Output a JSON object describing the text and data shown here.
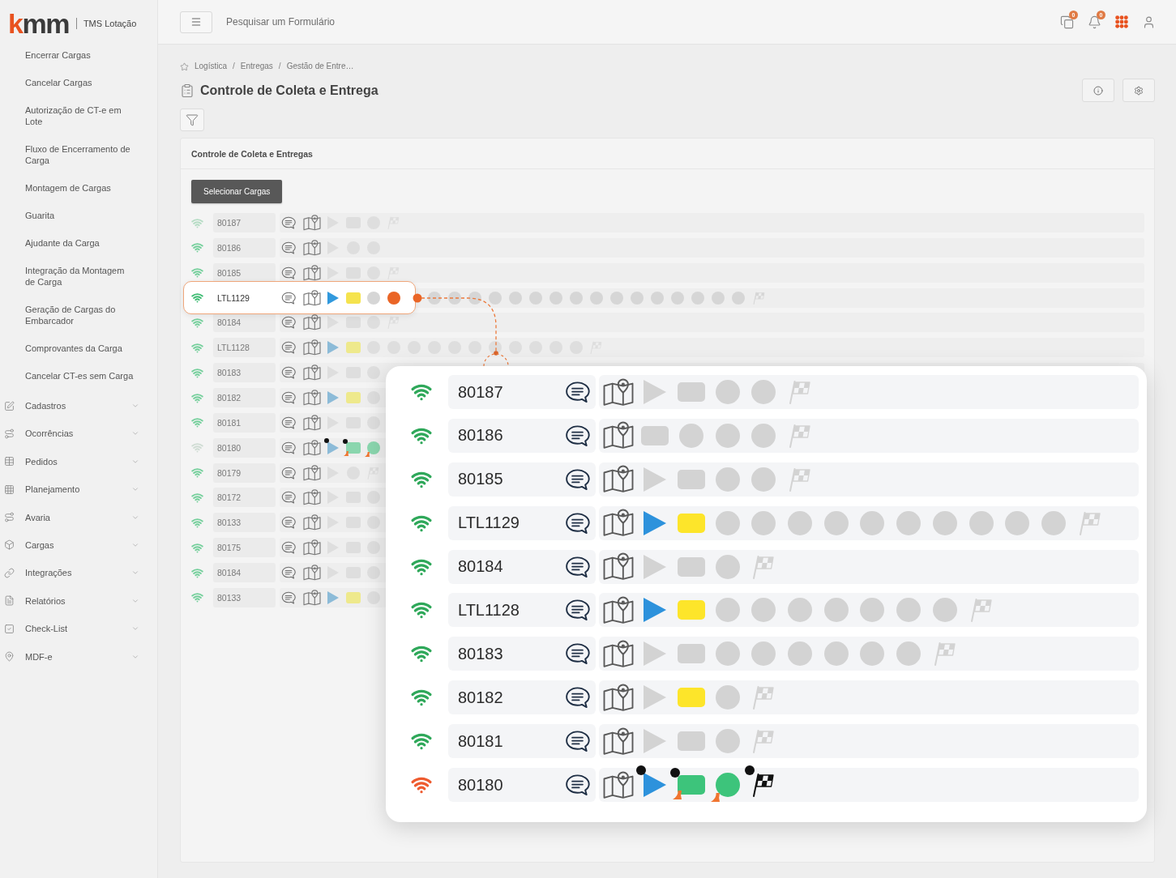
{
  "sidebar": {
    "logo": {
      "accent": "k",
      "rest": "mm",
      "product": "TMS Lotação"
    },
    "links": [
      "Encerrar Cargas",
      "Cancelar Cargas",
      "Autorização de CT-e em Lote",
      "Fluxo de Encerramento de Carga",
      "Montagem de Cargas",
      "Guarita",
      "Ajudante da Carga",
      "Integração da Montagem de Carga",
      "Geração de Cargas do Embarcador",
      "Comprovantes da Carga",
      "Cancelar CT-es sem Carga"
    ],
    "groups": [
      {
        "label": "Cadastros",
        "expanded": false
      },
      {
        "label": "Ocorrências",
        "expanded": false
      },
      {
        "label": "Pedidos",
        "expanded": false
      },
      {
        "label": "Planejamento",
        "expanded": false
      },
      {
        "label": "Avaria",
        "expanded": false
      },
      {
        "label": "Cargas",
        "expanded": false
      },
      {
        "label": "Integrações",
        "expanded": false
      },
      {
        "label": "Relatórios",
        "expanded": false
      },
      {
        "label": "Check-List",
        "expanded": false
      },
      {
        "label": "MDF-e",
        "expanded": false
      }
    ]
  },
  "topbar": {
    "search": {
      "placeholder": "Pesquisar um Formulário"
    },
    "badges": [
      "0",
      "0"
    ]
  },
  "breadcrumb": {
    "items": [
      "Logística",
      "Entregas",
      "Gestão de Entre…"
    ],
    "separator": "/"
  },
  "page": {
    "title": "Controle de Coleta e Entrega"
  },
  "card": {
    "title": "Controle de Coleta e Entregas",
    "button": "Selecionar Cargas",
    "rows": [
      {
        "id": "80187",
        "color": "#b5dcc4",
        "selected": false,
        "steps": [
          {
            "kind": "start",
            "done": false
          },
          {
            "kind": "stop",
            "done": false
          },
          {
            "kind": "point",
            "done": false
          },
          {
            "kind": "finish",
            "done": false
          }
        ]
      },
      {
        "id": "80186",
        "color": "#74cf9b",
        "selected": false,
        "steps": [
          {
            "kind": "start",
            "done": false
          },
          {
            "kind": "point",
            "done": false
          },
          {
            "kind": "point",
            "done": false
          }
        ]
      },
      {
        "id": "80185",
        "color": "#74cf9b",
        "selected": false,
        "steps": [
          {
            "kind": "start",
            "done": false
          },
          {
            "kind": "stop",
            "done": false
          },
          {
            "kind": "point",
            "done": false
          },
          {
            "kind": "finish",
            "done": false
          }
        ]
      },
      {
        "id": "LTL1129",
        "color": "#3dbb72",
        "selected": true,
        "steps": [
          {
            "kind": "start",
            "done": true
          },
          {
            "kind": "stop",
            "done": false,
            "active": true
          },
          {
            "kind": "point",
            "done": false
          },
          {
            "kind": "point",
            "done": false,
            "highlighted": true
          },
          {
            "kind": "point",
            "done": false
          },
          {
            "kind": "point",
            "done": false
          },
          {
            "kind": "point",
            "done": false
          },
          {
            "kind": "point",
            "done": false
          },
          {
            "kind": "point",
            "done": false
          },
          {
            "kind": "point",
            "done": false
          },
          {
            "kind": "point",
            "done": false
          },
          {
            "kind": "point",
            "done": false
          },
          {
            "kind": "point",
            "done": false
          },
          {
            "kind": "point",
            "done": false
          },
          {
            "kind": "point",
            "done": false
          },
          {
            "kind": "point",
            "done": false
          },
          {
            "kind": "point",
            "done": false
          },
          {
            "kind": "point",
            "done": false
          },
          {
            "kind": "point",
            "done": false
          },
          {
            "kind": "point",
            "done": false
          },
          {
            "kind": "finish",
            "done": false
          }
        ]
      },
      {
        "id": "80184",
        "color": "#74cf9b",
        "selected": false,
        "steps": [
          {
            "kind": "start",
            "done": false
          },
          {
            "kind": "stop",
            "done": false
          },
          {
            "kind": "point",
            "done": false
          },
          {
            "kind": "finish",
            "done": false
          }
        ]
      },
      {
        "id": "LTL1128",
        "color": "#74cf9b",
        "selected": false,
        "steps": [
          {
            "kind": "start",
            "done": true
          },
          {
            "kind": "stop",
            "done": false,
            "active": true
          },
          {
            "kind": "point",
            "done": false
          },
          {
            "kind": "point",
            "done": false
          },
          {
            "kind": "point",
            "done": false
          },
          {
            "kind": "point",
            "done": false
          },
          {
            "kind": "point",
            "done": false
          },
          {
            "kind": "point",
            "done": false
          },
          {
            "kind": "point",
            "done": false
          },
          {
            "kind": "point",
            "done": false
          },
          {
            "kind": "point",
            "done": false
          },
          {
            "kind": "point",
            "done": false
          },
          {
            "kind": "point",
            "done": false
          },
          {
            "kind": "finish",
            "done": false
          }
        ]
      },
      {
        "id": "80183",
        "color": "#74cf9b",
        "selected": false,
        "steps": [
          {
            "kind": "start",
            "done": false
          },
          {
            "kind": "stop",
            "done": false
          },
          {
            "kind": "point",
            "done": false
          }
        ]
      },
      {
        "id": "80182",
        "color": "#74cf9b",
        "selected": false,
        "steps": [
          {
            "kind": "start",
            "done": true
          },
          {
            "kind": "stop",
            "done": false,
            "active": true
          },
          {
            "kind": "point",
            "done": false
          }
        ]
      },
      {
        "id": "80181",
        "color": "#74cf9b",
        "selected": false,
        "steps": [
          {
            "kind": "start",
            "done": false
          },
          {
            "kind": "stop",
            "done": false
          },
          {
            "kind": "point",
            "done": false
          }
        ]
      },
      {
        "id": "80180",
        "color": "#cfdcd3",
        "selected": false,
        "steps": [
          {
            "kind": "start",
            "done": true,
            "dot": true
          },
          {
            "kind": "stop",
            "done": true,
            "dot": true,
            "tail": true
          },
          {
            "kind": "point",
            "done": true,
            "tail": true
          }
        ]
      },
      {
        "id": "80179",
        "color": "#74cf9b",
        "selected": false,
        "steps": [
          {
            "kind": "start",
            "done": false
          },
          {
            "kind": "point",
            "done": false
          },
          {
            "kind": "finish",
            "done": false
          }
        ]
      },
      {
        "id": "80172",
        "color": "#74cf9b",
        "selected": false,
        "steps": [
          {
            "kind": "start",
            "done": false
          },
          {
            "kind": "stop",
            "done": false
          },
          {
            "kind": "point",
            "done": false
          }
        ]
      },
      {
        "id": "80133",
        "color": "#74cf9b",
        "selected": false,
        "steps": [
          {
            "kind": "start",
            "done": false
          },
          {
            "kind": "stop",
            "done": false
          },
          {
            "kind": "point",
            "done": false
          }
        ]
      },
      {
        "id": "80175",
        "color": "#74cf9b",
        "selected": false,
        "steps": [
          {
            "kind": "start",
            "done": false
          },
          {
            "kind": "stop",
            "done": false
          },
          {
            "kind": "point",
            "done": false
          }
        ]
      },
      {
        "id": "80184",
        "color": "#74cf9b",
        "selected": false,
        "steps": [
          {
            "kind": "start",
            "done": false
          },
          {
            "kind": "stop",
            "done": false
          },
          {
            "kind": "point",
            "done": false
          }
        ]
      },
      {
        "id": "80133",
        "color": "#74cf9b",
        "selected": false,
        "steps": [
          {
            "kind": "start",
            "done": true
          },
          {
            "kind": "stop",
            "done": false,
            "active": true
          },
          {
            "kind": "point",
            "done": false
          }
        ]
      }
    ]
  },
  "popup": {
    "rows": [
      {
        "id": "80187",
        "color": "#2fa85a",
        "steps": [
          {
            "kind": "start",
            "done": false
          },
          {
            "kind": "stop",
            "done": false
          },
          {
            "kind": "point",
            "done": false
          },
          {
            "kind": "point",
            "done": false
          },
          {
            "kind": "finish",
            "done": false
          }
        ]
      },
      {
        "id": "80186",
        "color": "#2fa85a",
        "steps": [
          {
            "kind": "stop",
            "done": false
          },
          {
            "kind": "point",
            "done": false
          },
          {
            "kind": "point",
            "done": false
          },
          {
            "kind": "point",
            "done": false
          },
          {
            "kind": "finish",
            "done": false
          }
        ]
      },
      {
        "id": "80185",
        "color": "#2fa85a",
        "steps": [
          {
            "kind": "start",
            "done": false
          },
          {
            "kind": "stop",
            "done": false
          },
          {
            "kind": "point",
            "done": false
          },
          {
            "kind": "point",
            "done": false
          },
          {
            "kind": "finish",
            "done": false
          }
        ]
      },
      {
        "id": "LTL1129",
        "color": "#2fa85a",
        "steps": [
          {
            "kind": "start",
            "done": true
          },
          {
            "kind": "stop",
            "done": false,
            "active": true
          },
          {
            "kind": "point",
            "done": false
          },
          {
            "kind": "point",
            "done": false
          },
          {
            "kind": "point",
            "done": false
          },
          {
            "kind": "point",
            "done": false
          },
          {
            "kind": "point",
            "done": false
          },
          {
            "kind": "point",
            "done": false
          },
          {
            "kind": "point",
            "done": false
          },
          {
            "kind": "point",
            "done": false
          },
          {
            "kind": "point",
            "done": false
          },
          {
            "kind": "point",
            "done": false
          },
          {
            "kind": "finish",
            "done": false
          }
        ]
      },
      {
        "id": "80184",
        "color": "#2fa85a",
        "steps": [
          {
            "kind": "start",
            "done": false
          },
          {
            "kind": "stop",
            "done": false
          },
          {
            "kind": "point",
            "done": false
          },
          {
            "kind": "finish",
            "done": false
          }
        ]
      },
      {
        "id": "LTL1128",
        "color": "#2fa85a",
        "steps": [
          {
            "kind": "start",
            "done": true
          },
          {
            "kind": "stop",
            "done": false,
            "active": true
          },
          {
            "kind": "point",
            "done": false
          },
          {
            "kind": "point",
            "done": false
          },
          {
            "kind": "point",
            "done": false
          },
          {
            "kind": "point",
            "done": false
          },
          {
            "kind": "point",
            "done": false
          },
          {
            "kind": "point",
            "done": false
          },
          {
            "kind": "point",
            "done": false
          },
          {
            "kind": "finish",
            "done": false
          }
        ]
      },
      {
        "id": "80183",
        "color": "#2fa85a",
        "steps": [
          {
            "kind": "start",
            "done": false
          },
          {
            "kind": "stop",
            "done": false
          },
          {
            "kind": "point",
            "done": false
          },
          {
            "kind": "point",
            "done": false
          },
          {
            "kind": "point",
            "done": false
          },
          {
            "kind": "point",
            "done": false
          },
          {
            "kind": "point",
            "done": false
          },
          {
            "kind": "point",
            "done": false
          },
          {
            "kind": "finish",
            "done": false
          }
        ]
      },
      {
        "id": "80182",
        "color": "#2fa85a",
        "steps": [
          {
            "kind": "start",
            "done": false
          },
          {
            "kind": "stop",
            "done": false,
            "active": true
          },
          {
            "kind": "point",
            "done": false
          },
          {
            "kind": "finish",
            "done": false
          }
        ]
      },
      {
        "id": "80181",
        "color": "#2fa85a",
        "steps": [
          {
            "kind": "start",
            "done": false
          },
          {
            "kind": "stop",
            "done": false
          },
          {
            "kind": "point",
            "done": false
          },
          {
            "kind": "finish",
            "done": false
          }
        ]
      },
      {
        "id": "80180",
        "color": "#ee5b2f",
        "steps": [
          {
            "kind": "start",
            "done": true,
            "dot": true
          },
          {
            "kind": "stop",
            "done": true,
            "dot": true,
            "tail": true
          },
          {
            "kind": "point",
            "done": true,
            "tail": true
          },
          {
            "kind": "finish",
            "done": true,
            "dot": true
          }
        ]
      }
    ]
  }
}
